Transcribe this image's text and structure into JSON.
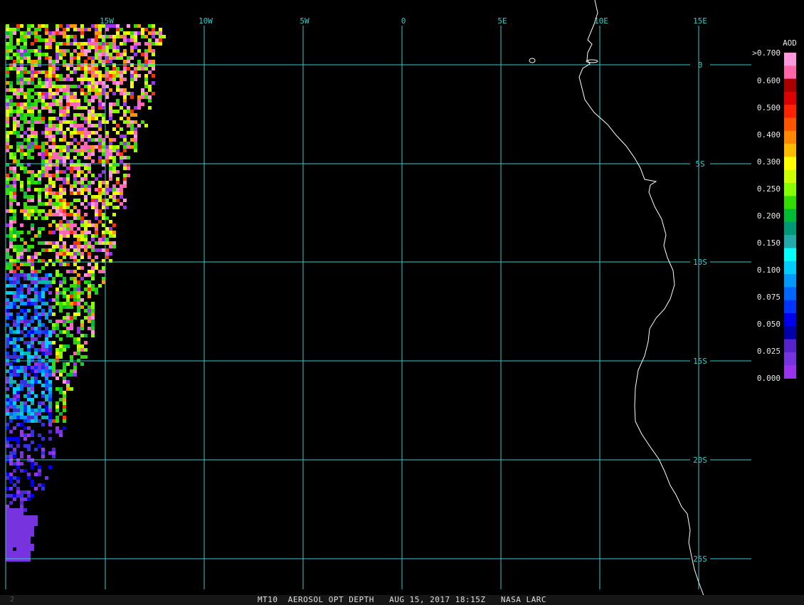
{
  "footer": {
    "product_line": "MT10  AEROSOL OPT DEPTH   AUG 15, 2017 18:15Z   NASA LARC",
    "left_mark": "2"
  },
  "map": {
    "lon_labels": [
      "15W",
      "10W",
      "5W",
      "0",
      "5E",
      "10E",
      "15E"
    ],
    "lat_labels": [
      "0",
      "5S",
      "10S",
      "15S",
      "20S",
      "25S"
    ],
    "grid_color": "#33cccc",
    "coast_color": "#ffffff",
    "background": "#000000"
  },
  "legend": {
    "title": "AOD",
    "tick_labels": [
      ">0.700",
      "0.600",
      "0.500",
      "0.400",
      "0.300",
      "0.250",
      "0.200",
      "0.150",
      "0.100",
      "0.075",
      "0.050",
      "0.025",
      "0.000"
    ],
    "colors": [
      "#ff99dd",
      "#ff66aa",
      "#aa0000",
      "#dd0000",
      "#ff2200",
      "#ff5500",
      "#ff8800",
      "#ffbb00",
      "#ffff00",
      "#ccff00",
      "#88ff00",
      "#33dd00",
      "#00bb33",
      "#009977",
      "#22aaaa",
      "#00ffff",
      "#00ccff",
      "#0099ff",
      "#0066ff",
      "#0033ff",
      "#0000ee",
      "#0000aa",
      "#5522cc",
      "#7733dd",
      "#9933ee"
    ]
  }
}
